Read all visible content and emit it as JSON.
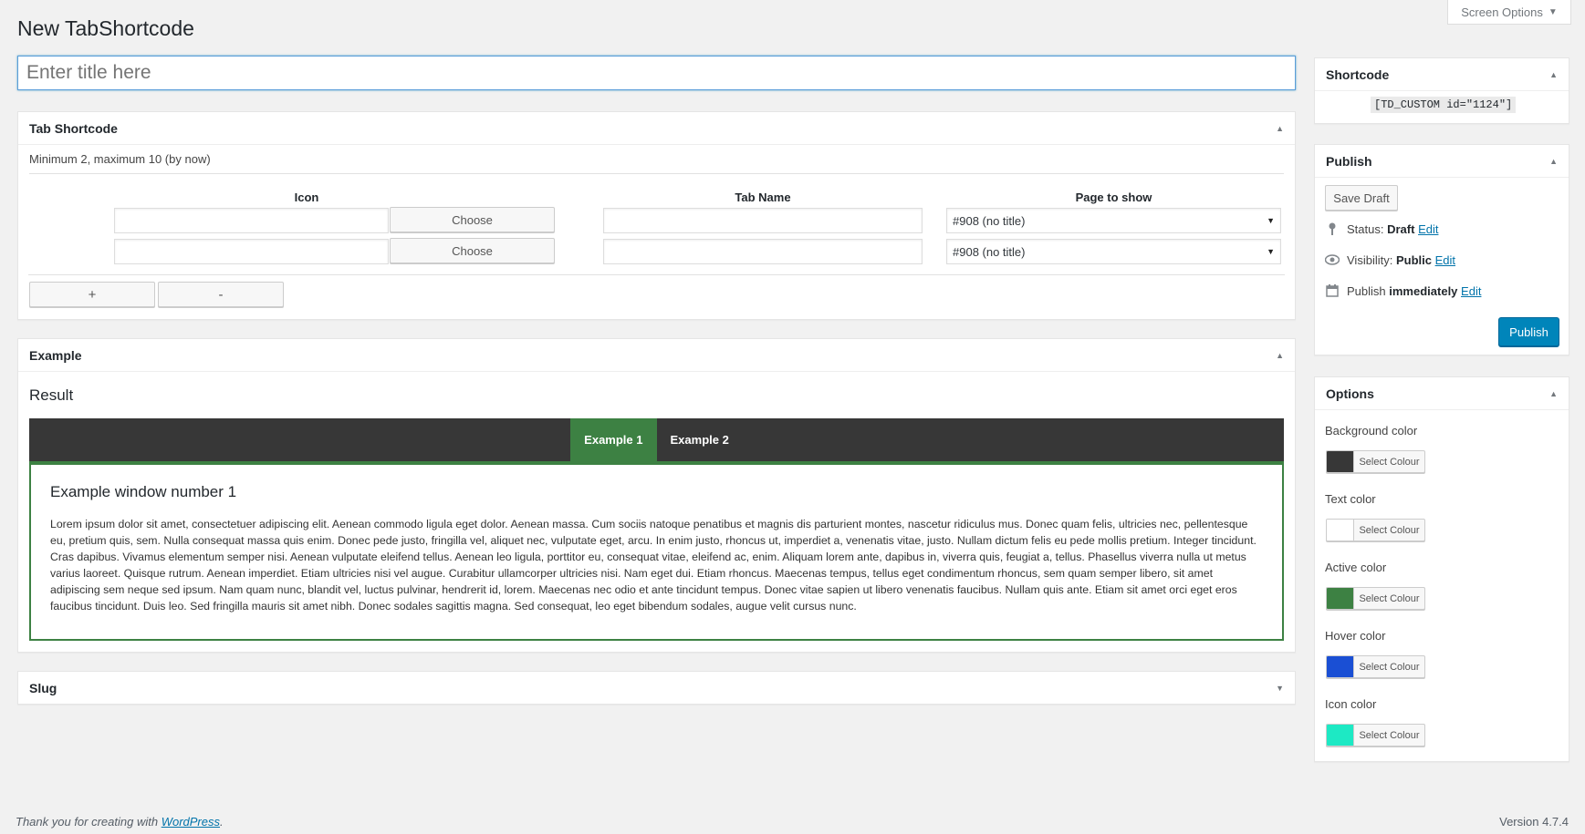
{
  "screen_options": {
    "label": "Screen Options"
  },
  "page_title": "New TabShortcode",
  "title_input": {
    "placeholder": "Enter title here",
    "value": ""
  },
  "tab_shortcode_box": {
    "title": "Tab Shortcode",
    "hint": "Minimum 2, maximum 10 (by now)",
    "columns": {
      "icon": "Icon",
      "tab_name": "Tab Name",
      "page": "Page to show"
    },
    "rows": [
      {
        "icon": "",
        "choose_label": "Choose",
        "tab_name": "",
        "page": "#908 (no title)"
      },
      {
        "icon": "",
        "choose_label": "Choose",
        "tab_name": "",
        "page": "#908 (no title)"
      }
    ],
    "add_label": "+",
    "remove_label": "-"
  },
  "example_box": {
    "title": "Example",
    "result_title": "Result",
    "tabs": [
      "Example 1",
      "Example 2"
    ],
    "window_title": "Example window number 1",
    "window_text": "Lorem ipsum dolor sit amet, consectetuer adipiscing elit. Aenean commodo ligula eget dolor. Aenean massa. Cum sociis natoque penatibus et magnis dis parturient montes, nascetur ridiculus mus. Donec quam felis, ultricies nec, pellentesque eu, pretium quis, sem. Nulla consequat massa quis enim. Donec pede justo, fringilla vel, aliquet nec, vulputate eget, arcu. In enim justo, rhoncus ut, imperdiet a, venenatis vitae, justo. Nullam dictum felis eu pede mollis pretium. Integer tincidunt. Cras dapibus. Vivamus elementum semper nisi. Aenean vulputate eleifend tellus. Aenean leo ligula, porttitor eu, consequat vitae, eleifend ac, enim. Aliquam lorem ante, dapibus in, viverra quis, feugiat a, tellus. Phasellus viverra nulla ut metus varius laoreet. Quisque rutrum. Aenean imperdiet. Etiam ultricies nisi vel augue. Curabitur ullamcorper ultricies nisi. Nam eget dui. Etiam rhoncus. Maecenas tempus, tellus eget condimentum rhoncus, sem quam semper libero, sit amet adipiscing sem neque sed ipsum. Nam quam nunc, blandit vel, luctus pulvinar, hendrerit id, lorem. Maecenas nec odio et ante tincidunt tempus. Donec vitae sapien ut libero venenatis faucibus. Nullam quis ante. Etiam sit amet orci eget eros faucibus tincidunt. Duis leo. Sed fringilla mauris sit amet nibh. Donec sodales sagittis magna. Sed consequat, leo eget bibendum sodales, augue velit cursus nunc."
  },
  "slug_box": {
    "title": "Slug"
  },
  "shortcode_box": {
    "title": "Shortcode",
    "code": "[TD_CUSTOM id=\"1124\"]"
  },
  "publish_box": {
    "title": "Publish",
    "save_draft": "Save Draft",
    "status_label": "Status:",
    "status_value": "Draft",
    "visibility_label": "Visibility:",
    "visibility_value": "Public",
    "publish_label": "Publish",
    "publish_value": "immediately",
    "edit": "Edit",
    "publish_button": "Publish"
  },
  "options_box": {
    "title": "Options",
    "select_label": "Select Colour",
    "colors": [
      {
        "label": "Background color",
        "value": "#373737"
      },
      {
        "label": "Text color",
        "value": "#ffffff"
      },
      {
        "label": "Active color",
        "value": "#3d8143"
      },
      {
        "label": "Hover color",
        "value": "#1a4fd4"
      },
      {
        "label": "Icon color",
        "value": "#1de9c4"
      }
    ]
  },
  "footer": {
    "thanks": "Thank you for creating with",
    "link": "WordPress",
    "version": "Version 4.7.4"
  },
  "theme": {
    "accent": "#0085ba",
    "link": "#0073aa",
    "tab_active": "#3d8143",
    "tab_bar": "#373737"
  }
}
